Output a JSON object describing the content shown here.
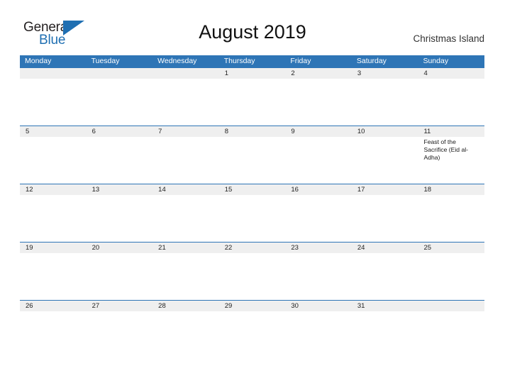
{
  "brand": {
    "name_part1": "General",
    "name_part2": "Blue",
    "primary_color": "#2e75b6"
  },
  "header": {
    "title": "August 2019",
    "subtitle": "Christmas Island"
  },
  "calendar": {
    "weekdays": [
      "Monday",
      "Tuesday",
      "Wednesday",
      "Thursday",
      "Friday",
      "Saturday",
      "Sunday"
    ],
    "weeks": [
      [
        {
          "day": "",
          "event": ""
        },
        {
          "day": "",
          "event": ""
        },
        {
          "day": "",
          "event": ""
        },
        {
          "day": "1",
          "event": ""
        },
        {
          "day": "2",
          "event": ""
        },
        {
          "day": "3",
          "event": ""
        },
        {
          "day": "4",
          "event": ""
        }
      ],
      [
        {
          "day": "5",
          "event": ""
        },
        {
          "day": "6",
          "event": ""
        },
        {
          "day": "7",
          "event": ""
        },
        {
          "day": "8",
          "event": ""
        },
        {
          "day": "9",
          "event": ""
        },
        {
          "day": "10",
          "event": ""
        },
        {
          "day": "11",
          "event": "Feast of the Sacrifice (Eid al-Adha)"
        }
      ],
      [
        {
          "day": "12",
          "event": ""
        },
        {
          "day": "13",
          "event": ""
        },
        {
          "day": "14",
          "event": ""
        },
        {
          "day": "15",
          "event": ""
        },
        {
          "day": "16",
          "event": ""
        },
        {
          "day": "17",
          "event": ""
        },
        {
          "day": "18",
          "event": ""
        }
      ],
      [
        {
          "day": "19",
          "event": ""
        },
        {
          "day": "20",
          "event": ""
        },
        {
          "day": "21",
          "event": ""
        },
        {
          "day": "22",
          "event": ""
        },
        {
          "day": "23",
          "event": ""
        },
        {
          "day": "24",
          "event": ""
        },
        {
          "day": "25",
          "event": ""
        }
      ],
      [
        {
          "day": "26",
          "event": ""
        },
        {
          "day": "27",
          "event": ""
        },
        {
          "day": "28",
          "event": ""
        },
        {
          "day": "29",
          "event": ""
        },
        {
          "day": "30",
          "event": ""
        },
        {
          "day": "31",
          "event": ""
        },
        {
          "day": "",
          "event": ""
        }
      ]
    ]
  }
}
